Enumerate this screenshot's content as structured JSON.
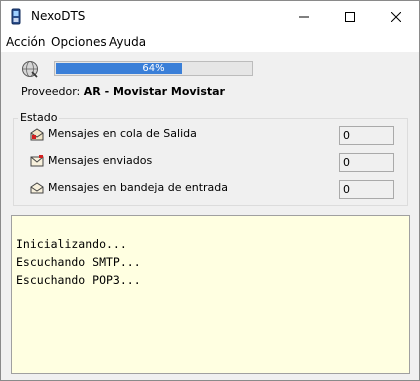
{
  "window": {
    "title": "NexoDTS"
  },
  "menu": {
    "items": [
      "Acción",
      "Opciones",
      "Ayuda"
    ]
  },
  "progress": {
    "value": 0.64,
    "label": "64%"
  },
  "proveedor": {
    "label": "Proveedor:",
    "value": "AR - Movistar Movistar"
  },
  "estado": {
    "title": "Estado",
    "rows": [
      {
        "icon": "outbox-icon",
        "label": "Mensajes en cola de Salida",
        "value": "0"
      },
      {
        "icon": "sent-mail-icon",
        "label": "Mensajes enviados",
        "value": "0"
      },
      {
        "icon": "envelope-icon",
        "label": "Mensajes en bandeja de entrada",
        "value": "0"
      }
    ]
  },
  "log": {
    "lines": [
      "Inicializando...",
      "Escuchando SMTP...",
      "Escuchando POP3..."
    ]
  },
  "colors": {
    "progress_fill": "#3a7fd8",
    "log_background": "#ffffe1"
  }
}
